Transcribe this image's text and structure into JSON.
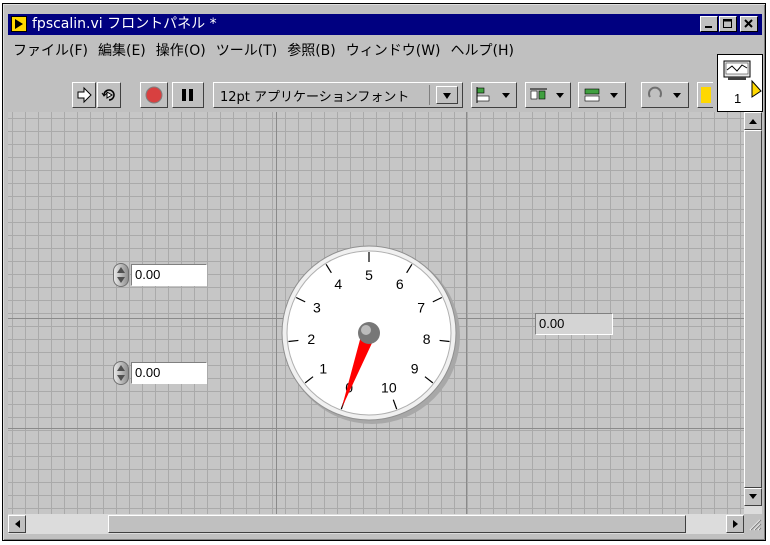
{
  "window": {
    "title": "fpscalin.vi フロントパネル *"
  },
  "menu": {
    "items": [
      "ファイル(F)",
      "編集(E)",
      "操作(O)",
      "ツール(T)",
      "参照(B)",
      "ウィンドウ(W)",
      "ヘルプ(H)"
    ]
  },
  "toolbar": {
    "font": "12pt アプリケーションフォント"
  },
  "vi_icon": {
    "label": "1"
  },
  "controls": {
    "control1_value": "0.00",
    "control2_value": "0.00",
    "indicator_value": "0.00"
  },
  "gauge": {
    "min": 0,
    "max": 10,
    "value": 0,
    "labels": [
      "0",
      "1",
      "2",
      "3",
      "4",
      "5",
      "6",
      "7",
      "8",
      "9",
      "10"
    ],
    "needle_color": "#ff0000"
  },
  "colors": {
    "titlebar": "#000080",
    "panel": "#c6c6c6"
  }
}
